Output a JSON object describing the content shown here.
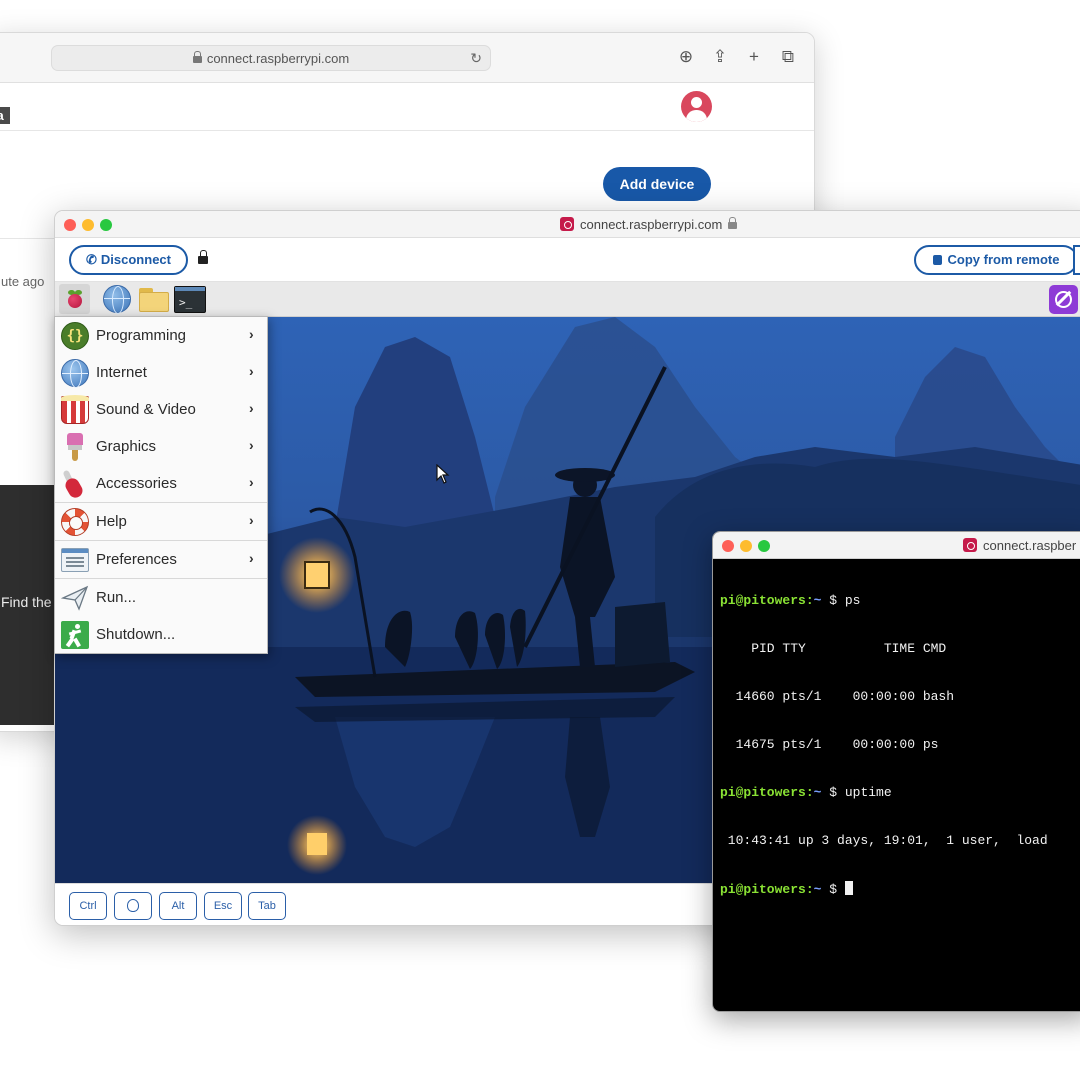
{
  "back_browser": {
    "address": "connect.raspberrypi.com",
    "badge": "eta",
    "add_device_label": "Add device",
    "time_text": "ute ago",
    "find_text": "Find the"
  },
  "remote_window": {
    "title": "connect.raspberrypi.com",
    "disconnect_label": "Disconnect",
    "copy_label": "Copy from remote",
    "keys": [
      "Ctrl",
      "Alt",
      "Esc",
      "Tab"
    ]
  },
  "start_menu": {
    "items": [
      {
        "label": "Programming",
        "submenu": true,
        "icon": "programming-icon"
      },
      {
        "label": "Internet",
        "submenu": true,
        "icon": "internet-icon"
      },
      {
        "label": "Sound & Video",
        "submenu": true,
        "icon": "sound-video-icon"
      },
      {
        "label": "Graphics",
        "submenu": true,
        "icon": "graphics-icon"
      },
      {
        "label": "Accessories",
        "submenu": true,
        "icon": "accessories-icon"
      },
      {
        "label": "Help",
        "submenu": true,
        "icon": "help-icon"
      },
      {
        "label": "Preferences",
        "submenu": true,
        "icon": "preferences-icon"
      },
      {
        "label": "Run...",
        "submenu": false,
        "icon": "run-icon"
      },
      {
        "label": "Shutdown...",
        "submenu": false,
        "icon": "shutdown-icon"
      }
    ],
    "chevron": "›"
  },
  "terminal": {
    "title": "connect.raspber",
    "prompt_user": "pi@pitowers:",
    "prompt_path": "~",
    "prompt_sign": " $ ",
    "cmd1": "ps",
    "ps_header": "    PID TTY          TIME CMD",
    "ps_row1": "  14660 pts/1    00:00:00 bash",
    "ps_row2": "  14675 pts/1    00:00:00 ps",
    "cmd2": "uptime",
    "uptime_out": " 10:43:41 up 3 days, 19:01,  1 user,  load"
  },
  "colors": {
    "brand_blue": "#1c5aa6",
    "add_device_blue": "#1858a8",
    "raspberry_red": "#c51a4a",
    "terminal_green": "#8ae234"
  }
}
